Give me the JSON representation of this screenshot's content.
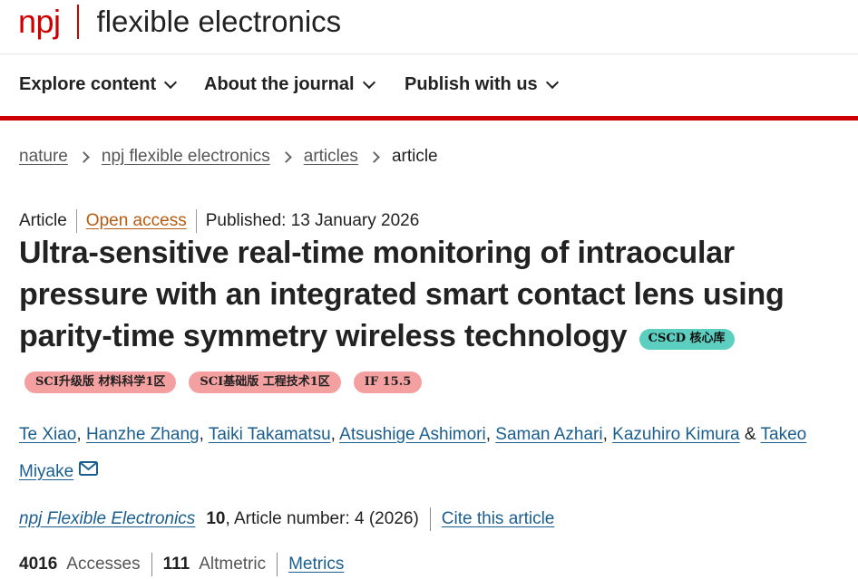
{
  "header": {
    "logo_brand": "npj",
    "logo_name": "flexible electronics"
  },
  "nav": [
    {
      "label": "Explore content"
    },
    {
      "label": "About the journal"
    },
    {
      "label": "Publish with us"
    }
  ],
  "breadcrumb": [
    {
      "label": "nature"
    },
    {
      "label": "npj flexible electronics"
    },
    {
      "label": "articles"
    },
    {
      "label": "article"
    }
  ],
  "article_meta": {
    "type": "Article",
    "access": "Open access",
    "published": "Published: 13 January 2026"
  },
  "title": "Ultra-sensitive real-time monitoring of intraocular pressure with an integrated smart contact lens using parity-time symmetry wireless technology",
  "cscd_badge": "CSCD 核心库",
  "badges": [
    "SCI升级版 材料科学1区",
    "SCI基础版 工程技术1区",
    "IF 15.5"
  ],
  "authors": [
    "Te Xiao",
    "Hanzhe Zhang",
    "Taiki Takamatsu",
    "Atsushige Ashimori",
    "Saman Azhari",
    "Kazuhiro Kimura",
    "Takeo Miyake"
  ],
  "journal_line": {
    "journal": "npj Flexible Electronics",
    "volume": "10",
    "article_number": ", Article number: 4 (2026)",
    "cite_label": "Cite this article"
  },
  "metrics": {
    "accesses_value": "4016",
    "accesses_label": "Accesses",
    "altmetric_value": "111",
    "altmetric_label": "Altmetric",
    "metrics_link": "Metrics"
  },
  "colors": {
    "brand_red": "#cc0000",
    "link_blue": "#1a5e8f",
    "open_access_orange": "#b75b12",
    "cscd_teal": "#5ccfc1",
    "badge_pink": "#f5a0a0"
  },
  "icons": [
    "chevron-down-icon",
    "chevron-right-icon",
    "mail-icon"
  ]
}
